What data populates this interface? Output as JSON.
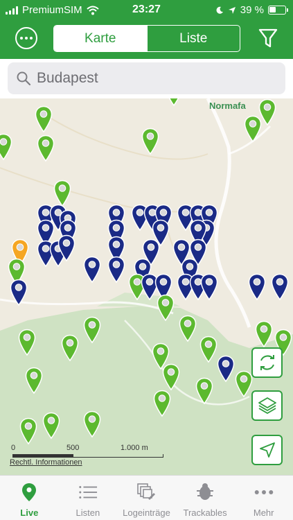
{
  "status_bar": {
    "carrier": "PremiumSIM",
    "time": "23:27",
    "battery_text": "39 %",
    "battery_level": 0.39
  },
  "header": {
    "segments": [
      {
        "label": "Karte",
        "active": true
      },
      {
        "label": "Liste",
        "active": false
      }
    ],
    "menu_icon": "more-icon",
    "filter_icon": "filter-icon"
  },
  "search": {
    "value": "Budapest",
    "icon": "search-icon"
  },
  "map": {
    "place_label": "Normafa",
    "scale": {
      "ticks": [
        "0",
        "500",
        "1.000 m"
      ]
    },
    "legal_link": "Rechtl. Informationen",
    "colors": {
      "green_pin": "#5cb92f",
      "blue_pin": "#1a2a86",
      "orange_pin": "#f5a623",
      "park": "#cfe2c3",
      "land": "#efebe0"
    },
    "buttons": [
      "refresh-icon",
      "layers-icon",
      "locate-icon"
    ]
  },
  "tabbar": {
    "tabs": [
      {
        "label": "Live",
        "icon": "map-pin-icon",
        "active": true
      },
      {
        "label": "Listen",
        "icon": "list-icon",
        "active": false
      },
      {
        "label": "Logeinträge",
        "icon": "logs-icon",
        "active": false
      },
      {
        "label": "Trackables",
        "icon": "trackable-icon",
        "active": false
      },
      {
        "label": "Mehr",
        "icon": "more-dots-icon",
        "active": false
      }
    ]
  }
}
